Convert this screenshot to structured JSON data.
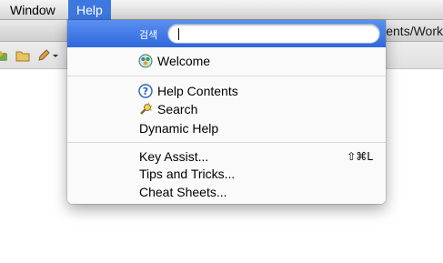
{
  "menubar": {
    "items": [
      {
        "label": "Window"
      },
      {
        "label": "Help"
      }
    ]
  },
  "window": {
    "title_fragment": "ents/Work"
  },
  "help_menu": {
    "search_label": "검색",
    "search_value": "",
    "items": [
      {
        "label": "Welcome",
        "icon": "welcome-icon"
      },
      {
        "label": "Help Contents",
        "icon": "help-question-icon"
      },
      {
        "label": "Search",
        "icon": "search-flashlight-icon"
      },
      {
        "label": "Dynamic Help"
      },
      {
        "label": "Key Assist...",
        "shortcut": "⇧⌘L"
      },
      {
        "label": "Tips and Tricks..."
      },
      {
        "label": "Cheat Sheets..."
      }
    ]
  },
  "colors": {
    "selection_blue": "#3d78e0",
    "menu_bg": "#fafafa"
  }
}
